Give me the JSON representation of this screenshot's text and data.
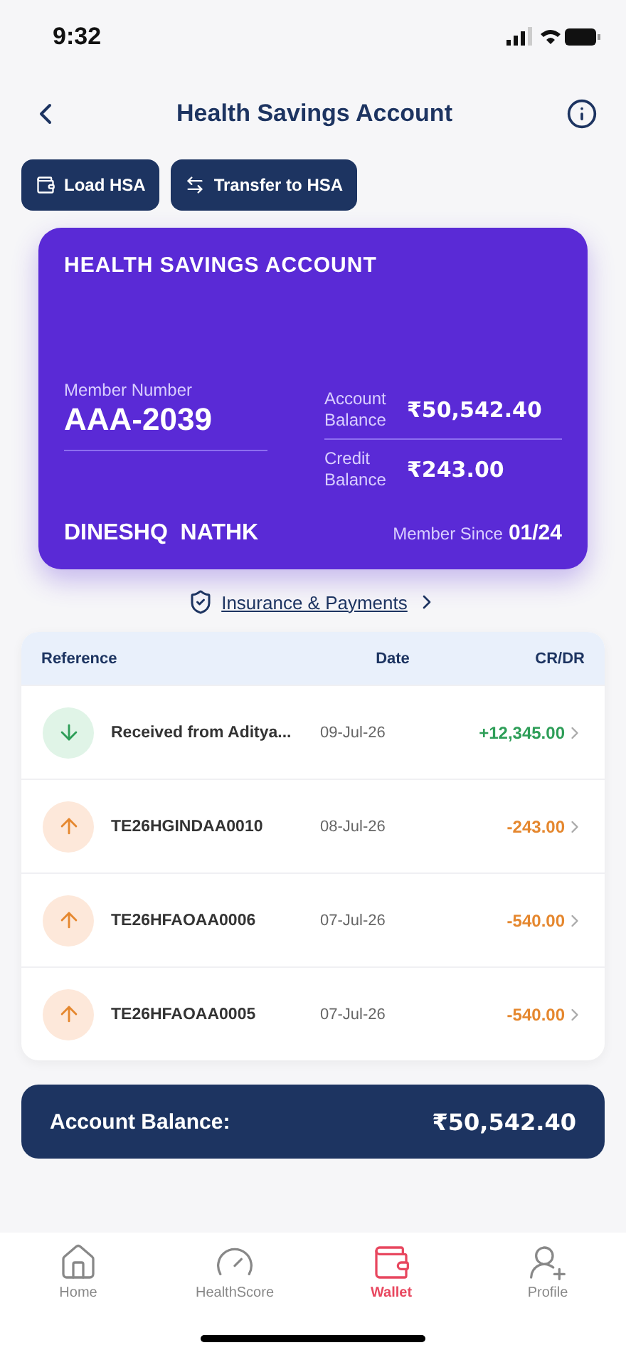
{
  "status_bar": {
    "time": "9:32"
  },
  "header": {
    "title": "Health Savings Account"
  },
  "actions": [
    {
      "kind": "load",
      "label": "Load HSA"
    },
    {
      "kind": "transfer",
      "label": "Transfer to HSA"
    }
  ],
  "card": {
    "title": "HEALTH SAVINGS ACCOUNT",
    "member_number_label": "Member Number",
    "member_number": "AAA-2039",
    "balances": [
      {
        "label": "Account Balance",
        "value": "₹50,542.40"
      },
      {
        "label": "Credit Balance",
        "value": "₹243.00"
      }
    ],
    "name": "DINESHQ  NATHK",
    "member_since_label": "Member Since",
    "member_since": "01/24"
  },
  "link": {
    "label": "Insurance & Payments"
  },
  "table": {
    "columns": [
      "Reference",
      "Date",
      "CR/DR"
    ],
    "rows": [
      {
        "kind": "credit",
        "reference": "Received from Aditya...",
        "date": "09-Jul-26",
        "amount": "+12,345.00"
      },
      {
        "kind": "debit",
        "reference": "TE26HGINDAA0010",
        "date": "08-Jul-26",
        "amount": "-243.00"
      },
      {
        "kind": "debit",
        "reference": "TE26HFAOAA0006",
        "date": "07-Jul-26",
        "amount": "-540.00"
      },
      {
        "kind": "debit",
        "reference": "TE26HFAOAA0005",
        "date": "07-Jul-26",
        "amount": "-540.00"
      }
    ]
  },
  "balance_bar": {
    "label": "Account Balance:",
    "value": "₹50,542.40"
  },
  "nav": [
    {
      "kind": "home",
      "label": "Home",
      "selected": false
    },
    {
      "kind": "score",
      "label": "HealthScore",
      "selected": false
    },
    {
      "kind": "wallet",
      "label": "Wallet",
      "selected": true
    },
    {
      "kind": "profile",
      "label": "Profile",
      "selected": false
    }
  ]
}
